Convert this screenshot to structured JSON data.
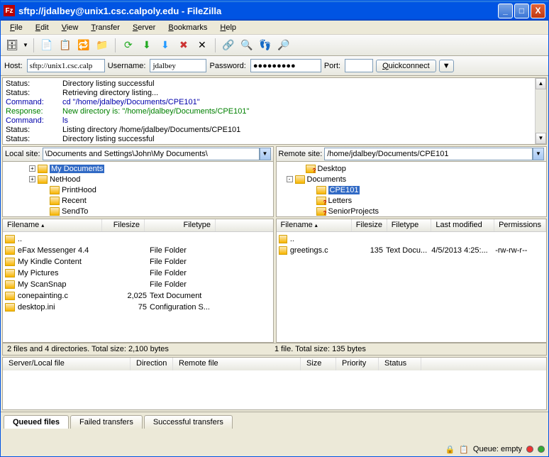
{
  "title": "sftp://jdalbey@unix1.csc.calpoly.edu - FileZilla",
  "menus": {
    "file": "File",
    "edit": "Edit",
    "view": "View",
    "transfer": "Transfer",
    "server": "Server",
    "bookmarks": "Bookmarks",
    "help": "Help"
  },
  "quick": {
    "host_label": "Host:",
    "host": "sftp://unix1.csc.calp",
    "user_label": "Username:",
    "user": "jdalbey",
    "pass_label": "Password:",
    "pass": "●●●●●●●●●",
    "port_label": "Port:",
    "port": "",
    "btn": "Quickconnect"
  },
  "log": [
    {
      "t": "Status:",
      "m": "Directory listing successful",
      "c": ""
    },
    {
      "t": "Status:",
      "m": "Retrieving directory listing...",
      "c": ""
    },
    {
      "t": "Command:",
      "m": "cd \"/home/jdalbey/Documents/CPE101\"",
      "c": "lblue"
    },
    {
      "t": "Response:",
      "m": "New directory is: \"/home/jdalbey/Documents/CPE101\"",
      "c": "lgreen"
    },
    {
      "t": "Command:",
      "m": "ls",
      "c": "lblue"
    },
    {
      "t": "Status:",
      "m": "Listing directory /home/jdalbey/Documents/CPE101",
      "c": ""
    },
    {
      "t": "Status:",
      "m": "Directory listing successful",
      "c": ""
    }
  ],
  "local": {
    "label": "Local site:",
    "path": "\\Documents and Settings\\John\\My Documents\\",
    "tree": [
      {
        "pad": 35,
        "pm": "+",
        "name": "My Documents",
        "icon": "folder",
        "sel": true
      },
      {
        "pad": 35,
        "pm": "+",
        "name": "NetHood",
        "icon": "folder"
      },
      {
        "pad": 50,
        "pm": "",
        "name": "PrintHood",
        "icon": "folder"
      },
      {
        "pad": 50,
        "pm": "",
        "name": "Recent",
        "icon": "folder"
      },
      {
        "pad": 50,
        "pm": "",
        "name": "SendTo",
        "icon": "folder"
      }
    ],
    "cols": [
      "Filename",
      "Filesize",
      "Filetype"
    ],
    "files": [
      {
        "name": "..",
        "size": "",
        "type": ""
      },
      {
        "name": "eFax Messenger 4.4",
        "size": "",
        "type": "File Folder"
      },
      {
        "name": "My Kindle Content",
        "size": "",
        "type": "File Folder"
      },
      {
        "name": "My Pictures",
        "size": "",
        "type": "File Folder"
      },
      {
        "name": "My ScanSnap",
        "size": "",
        "type": "File Folder"
      },
      {
        "name": "conepainting.c",
        "size": "2,025",
        "type": "Text Document"
      },
      {
        "name": "desktop.ini",
        "size": "75",
        "type": "Configuration S..."
      }
    ],
    "status": "2 files and 4 directories. Total size: 2,100 bytes"
  },
  "remote": {
    "label": "Remote site:",
    "path": "/home/jdalbey/Documents/CPE101",
    "tree": [
      {
        "pad": 25,
        "pm": "",
        "name": "Desktop",
        "icon": "folder-q"
      },
      {
        "pad": 12,
        "pm": "-",
        "name": "Documents",
        "icon": "folder"
      },
      {
        "pad": 40,
        "pm": "",
        "name": "CPE101",
        "icon": "folder",
        "sel": true
      },
      {
        "pad": 40,
        "pm": "",
        "name": "Letters",
        "icon": "folder-q"
      },
      {
        "pad": 40,
        "pm": "",
        "name": "SeniorProjects",
        "icon": "folder-q"
      }
    ],
    "cols": [
      "Filename",
      "Filesize",
      "Filetype",
      "Last modified",
      "Permissions"
    ],
    "files": [
      {
        "name": "..",
        "size": "",
        "type": "",
        "mod": "",
        "perm": ""
      },
      {
        "name": "greetings.c",
        "size": "135",
        "type": "Text Docu...",
        "mod": "4/5/2013 4:25:...",
        "perm": "-rw-rw-r--"
      }
    ],
    "status": "1 file. Total size: 135 bytes"
  },
  "queue_cols": [
    "Server/Local file",
    "Direction",
    "Remote file",
    "Size",
    "Priority",
    "Status"
  ],
  "tabs": {
    "queued": "Queued files",
    "failed": "Failed transfers",
    "success": "Successful transfers"
  },
  "footer": {
    "queue": "Queue: empty"
  }
}
